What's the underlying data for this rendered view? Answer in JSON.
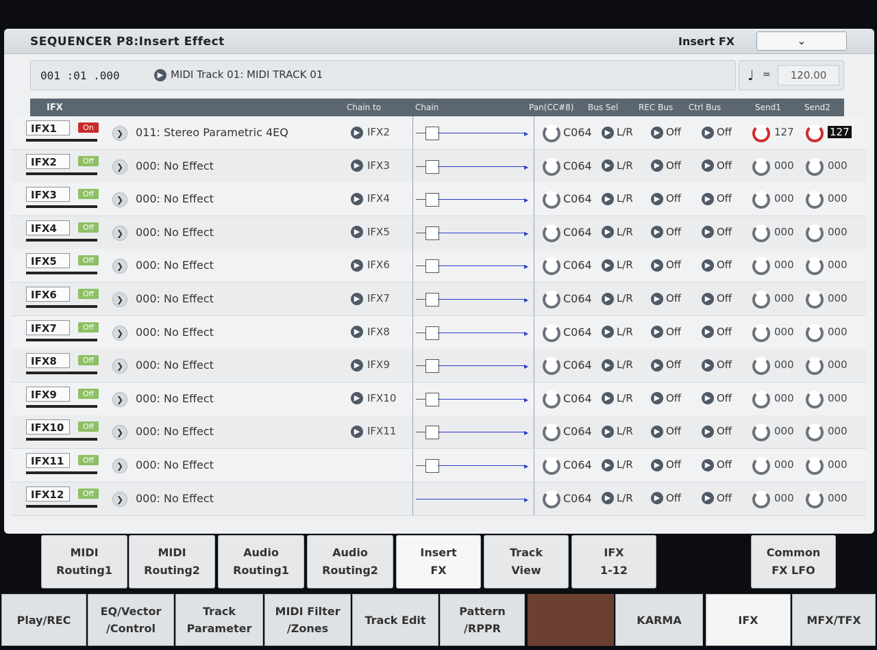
{
  "header": {
    "title": "SEQUENCER P8:Insert Effect",
    "page_menu_label": "Insert FX",
    "page_menu_icon": "chevron-down-icon"
  },
  "position": "001 :01 .000",
  "track_select": "MIDI Track 01: MIDI TRACK 01",
  "tempo": {
    "symbol": "♩",
    "equals": "=",
    "value": "120.00"
  },
  "columns": {
    "ifx": "IFX",
    "chain_to": "Chain to",
    "chain": "Chain",
    "pan": "Pan(CC#8)",
    "bus_sel": "Bus Sel",
    "rec_bus": "REC Bus",
    "ctrl_bus": "Ctrl Bus",
    "send1": "Send1",
    "send2": "Send2"
  },
  "rows": [
    {
      "ifx": "IFX1",
      "state": "On",
      "effect": "011: Stereo Parametric 4EQ",
      "chain_to": "IFX2",
      "pan": "C064",
      "bus_sel": "L/R",
      "rec_bus": "Off",
      "ctrl_bus": "Off",
      "send1": "127",
      "send2": "127"
    },
    {
      "ifx": "IFX2",
      "state": "Off",
      "effect": "000: No Effect",
      "chain_to": "IFX3",
      "pan": "C064",
      "bus_sel": "L/R",
      "rec_bus": "Off",
      "ctrl_bus": "Off",
      "send1": "000",
      "send2": "000"
    },
    {
      "ifx": "IFX3",
      "state": "Off",
      "effect": "000: No Effect",
      "chain_to": "IFX4",
      "pan": "C064",
      "bus_sel": "L/R",
      "rec_bus": "Off",
      "ctrl_bus": "Off",
      "send1": "000",
      "send2": "000"
    },
    {
      "ifx": "IFX4",
      "state": "Off",
      "effect": "000: No Effect",
      "chain_to": "IFX5",
      "pan": "C064",
      "bus_sel": "L/R",
      "rec_bus": "Off",
      "ctrl_bus": "Off",
      "send1": "000",
      "send2": "000"
    },
    {
      "ifx": "IFX5",
      "state": "Off",
      "effect": "000: No Effect",
      "chain_to": "IFX6",
      "pan": "C064",
      "bus_sel": "L/R",
      "rec_bus": "Off",
      "ctrl_bus": "Off",
      "send1": "000",
      "send2": "000"
    },
    {
      "ifx": "IFX6",
      "state": "Off",
      "effect": "000: No Effect",
      "chain_to": "IFX7",
      "pan": "C064",
      "bus_sel": "L/R",
      "rec_bus": "Off",
      "ctrl_bus": "Off",
      "send1": "000",
      "send2": "000"
    },
    {
      "ifx": "IFX7",
      "state": "Off",
      "effect": "000: No Effect",
      "chain_to": "IFX8",
      "pan": "C064",
      "bus_sel": "L/R",
      "rec_bus": "Off",
      "ctrl_bus": "Off",
      "send1": "000",
      "send2": "000"
    },
    {
      "ifx": "IFX8",
      "state": "Off",
      "effect": "000: No Effect",
      "chain_to": "IFX9",
      "pan": "C064",
      "bus_sel": "L/R",
      "rec_bus": "Off",
      "ctrl_bus": "Off",
      "send1": "000",
      "send2": "000"
    },
    {
      "ifx": "IFX9",
      "state": "Off",
      "effect": "000: No Effect",
      "chain_to": "IFX10",
      "pan": "C064",
      "bus_sel": "L/R",
      "rec_bus": "Off",
      "ctrl_bus": "Off",
      "send1": "000",
      "send2": "000"
    },
    {
      "ifx": "IFX10",
      "state": "Off",
      "effect": "000: No Effect",
      "chain_to": "IFX11",
      "pan": "C064",
      "bus_sel": "L/R",
      "rec_bus": "Off",
      "ctrl_bus": "Off",
      "send1": "000",
      "send2": "000"
    },
    {
      "ifx": "IFX11",
      "state": "Off",
      "effect": "000: No Effect",
      "chain_to": "",
      "pan": "C064",
      "bus_sel": "L/R",
      "rec_bus": "Off",
      "ctrl_bus": "Off",
      "send1": "000",
      "send2": "000"
    },
    {
      "ifx": "IFX12",
      "state": "Off",
      "effect": "000: No Effect",
      "chain_to": "",
      "pan": "C064",
      "bus_sel": "L/R",
      "rec_bus": "Off",
      "ctrl_bus": "Off",
      "send1": "000",
      "send2": "000"
    }
  ],
  "sub_tabs": [
    {
      "line1": "MIDI",
      "line2": "Routing1"
    },
    {
      "line1": "MIDI",
      "line2": "Routing2"
    },
    {
      "line1": "Audio",
      "line2": "Routing1"
    },
    {
      "line1": "Audio",
      "line2": "Routing2"
    },
    {
      "line1": "Insert",
      "line2": "FX"
    },
    {
      "line1": "Track",
      "line2": "View"
    },
    {
      "line1": "IFX",
      "line2": "1-12"
    },
    {
      "line1": "Common",
      "line2": "FX LFO"
    }
  ],
  "main_tabs": [
    {
      "line1": "Play/REC",
      "line2": ""
    },
    {
      "line1": "EQ/Vector",
      "line2": "/Control"
    },
    {
      "line1": "Track",
      "line2": "Parameter"
    },
    {
      "line1": "MIDI Filter",
      "line2": "/Zones"
    },
    {
      "line1": "Track Edit",
      "line2": ""
    },
    {
      "line1": "Pattern",
      "line2": "/RPPR"
    },
    {
      "line1": "KARMA",
      "line2": ""
    },
    {
      "line1": "IFX",
      "line2": ""
    },
    {
      "line1": "MFX/TFX",
      "line2": ""
    }
  ],
  "colors": {
    "on": "#c92b2b",
    "off": "#8dc063",
    "chain_line": "#2b3bc8",
    "header_bg": "#5c6670"
  }
}
